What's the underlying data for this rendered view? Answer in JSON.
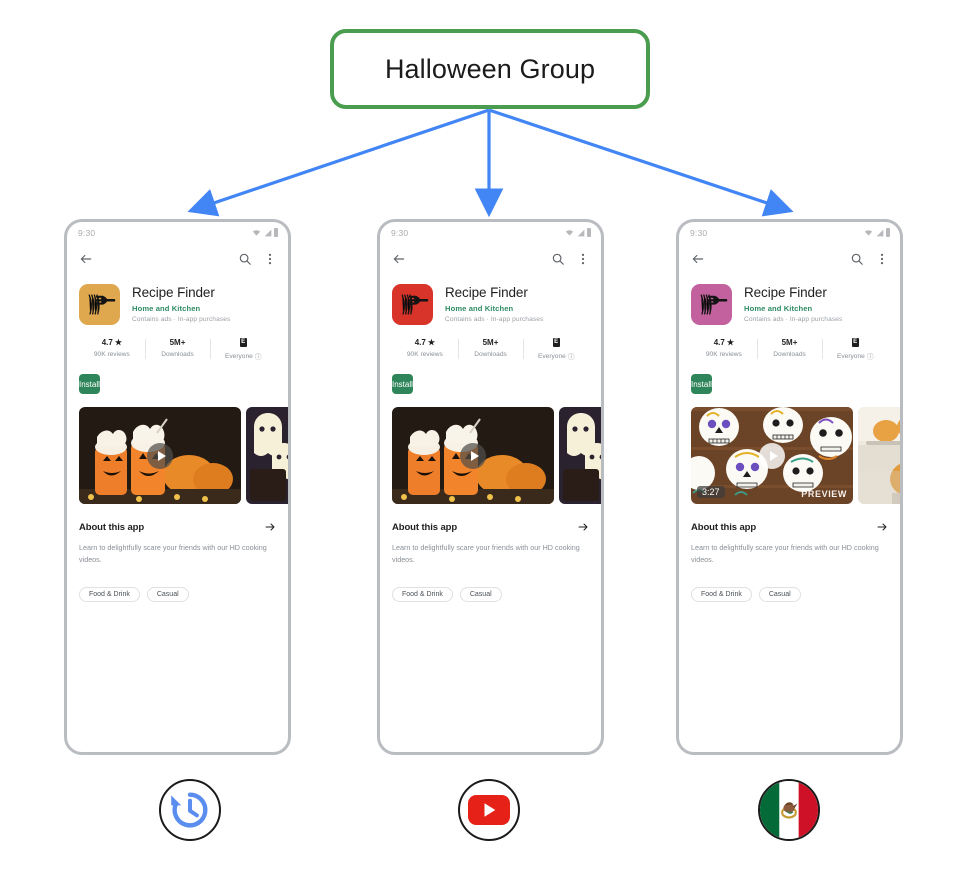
{
  "title": {
    "text": "Halloween Group",
    "border_color": "#4a9d4f"
  },
  "arrow_color": "#4285f4",
  "phones": [
    {
      "id": "phone-1",
      "status_bar": {
        "time": "9:30",
        "wifi_icon": "wifi-icon",
        "signal_icon": "signal-icon",
        "battery_icon": "battery-icon"
      },
      "appbar": {
        "back_icon": "back-arrow-icon",
        "search_icon": "search-icon",
        "overflow_icon": "overflow-menu-icon"
      },
      "app": {
        "icon_name": "fork-noodles-icon",
        "icon_bg": "#e0a84e",
        "name": "Recipe Finder",
        "developer": "Home and Kitchen",
        "ads_note": "Contains ads  ·  In-app purchases"
      },
      "stats": [
        {
          "top": "4.7",
          "has_star": true,
          "sub": "90K reviews"
        },
        {
          "top": "5M+",
          "has_star": false,
          "sub": "Downloads"
        },
        {
          "top": "E",
          "is_rating_box": true,
          "sub": "Everyone",
          "has_info": true
        }
      ],
      "install_label": "Install",
      "carousel": {
        "main": {
          "name": "pumpkin-drinks-screenshot",
          "has_play": true,
          "play_style": "dark",
          "duration": "",
          "preview_label": ""
        },
        "next": {
          "name": "ghost-cupcakes-screenshot"
        }
      },
      "about": {
        "title": "About this app",
        "arrow_icon": "chevron-right-icon",
        "description": "Learn to delightfully scare your friends with our HD cooking videos."
      },
      "chips": [
        "Food & Drink",
        "Casual"
      ],
      "badge": {
        "name": "history-restore-icon",
        "label": "history"
      }
    },
    {
      "id": "phone-2",
      "status_bar": {
        "time": "9:30",
        "wifi_icon": "wifi-icon",
        "signal_icon": "signal-icon",
        "battery_icon": "battery-icon"
      },
      "appbar": {
        "back_icon": "back-arrow-icon",
        "search_icon": "search-icon",
        "overflow_icon": "overflow-menu-icon"
      },
      "app": {
        "icon_name": "fork-noodles-icon",
        "icon_bg": "#d8342a",
        "name": "Recipe Finder",
        "developer": "Home and Kitchen",
        "ads_note": "Contains ads  ·  In-app purchases"
      },
      "stats": [
        {
          "top": "4.7",
          "has_star": true,
          "sub": "90K reviews"
        },
        {
          "top": "5M+",
          "has_star": false,
          "sub": "Downloads"
        },
        {
          "top": "E",
          "is_rating_box": true,
          "sub": "Everyone",
          "has_info": true
        }
      ],
      "install_label": "Install",
      "carousel": {
        "main": {
          "name": "pumpkin-drinks-screenshot",
          "has_play": true,
          "play_style": "dark",
          "duration": "",
          "preview_label": ""
        },
        "next": {
          "name": "ghost-cupcakes-screenshot"
        }
      },
      "about": {
        "title": "About this app",
        "arrow_icon": "chevron-right-icon",
        "description": "Learn to delightfully scare your friends with our HD cooking videos."
      },
      "chips": [
        "Food & Drink",
        "Casual"
      ],
      "badge": {
        "name": "youtube-icon",
        "label": "youtube"
      }
    },
    {
      "id": "phone-3",
      "status_bar": {
        "time": "9:30",
        "wifi_icon": "wifi-icon",
        "signal_icon": "signal-icon",
        "battery_icon": "battery-icon"
      },
      "appbar": {
        "back_icon": "back-arrow-icon",
        "search_icon": "search-icon",
        "overflow_icon": "overflow-menu-icon"
      },
      "app": {
        "icon_name": "fork-noodles-icon",
        "icon_bg": "#c2619e",
        "name": "Recipe Finder",
        "developer": "Home and Kitchen",
        "ads_note": "Contains ads  ·  In-app purchases"
      },
      "stats": [
        {
          "top": "4.7",
          "has_star": true,
          "sub": "90K reviews"
        },
        {
          "top": "5M+",
          "has_star": false,
          "sub": "Downloads"
        },
        {
          "top": "E",
          "is_rating_box": true,
          "sub": "Everyone",
          "has_info": true
        }
      ],
      "install_label": "Install",
      "carousel": {
        "main": {
          "name": "sugar-skull-cookies-screenshot",
          "has_play": true,
          "play_style": "light",
          "duration": "3:27",
          "preview_label": "PREVIEW"
        },
        "next": {
          "name": "bread-rolls-screenshot"
        }
      },
      "about": {
        "title": "About this app",
        "arrow_icon": "chevron-right-icon",
        "description": "Learn to delightfully scare your friends with our HD cooking videos."
      },
      "chips": [
        "Food & Drink",
        "Casual"
      ],
      "badge": {
        "name": "mexico-flag-icon",
        "label": "mexico"
      }
    }
  ]
}
